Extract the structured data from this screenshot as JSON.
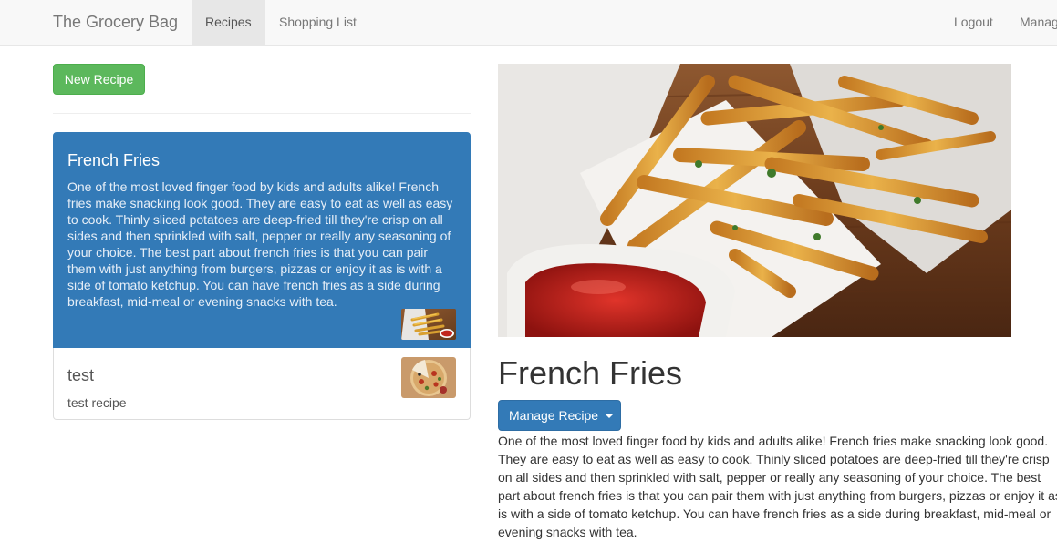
{
  "navbar": {
    "brand": "The Grocery Bag",
    "items": [
      {
        "label": "Recipes"
      },
      {
        "label": "Shopping List"
      }
    ],
    "right_items": [
      {
        "label": "Logout"
      },
      {
        "label": "Manage"
      }
    ]
  },
  "sidebar": {
    "new_recipe_label": "New Recipe",
    "recipes": [
      {
        "name": "French Fries",
        "description": "One of the most loved finger food by kids and adults alike! French fries make snacking look good. They are easy to eat as well as easy to cook. Thinly sliced potatoes are deep-fried till they're crisp on all sides and then sprinkled with salt, pepper or really any seasoning of your choice. The best part about french fries is that you can pair them with just anything from burgers, pizzas or enjoy it as is with a side of tomato ketchup. You can have french fries as a side during breakfast, mid-meal or evening snacks with tea."
      },
      {
        "name": "test",
        "description": "test recipe"
      }
    ]
  },
  "detail": {
    "title": "French Fries",
    "manage_label": "Manage Recipe",
    "description": "One of the most loved finger food by kids and adults alike! French fries make snacking look good. They are easy to eat as well as easy to cook. Thinly sliced potatoes are deep-fried till they're crisp on all sides and then sprinkled with salt, pepper or really any seasoning of your choice. The best part about french fries is that you can pair them with just anything from burgers, pizzas or enjoy it as is with a side of tomato ketchup. You can have french fries as a side during breakfast, mid-meal or evening snacks with tea."
  },
  "colors": {
    "primary": "#337ab7",
    "success": "#5cb85c",
    "navbar_bg": "#f8f8f8"
  }
}
